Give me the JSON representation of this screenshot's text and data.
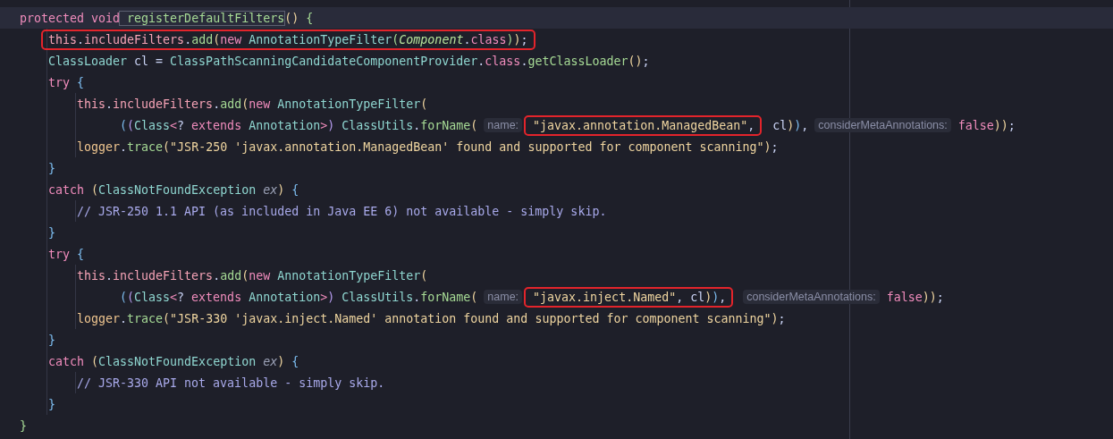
{
  "editor": {
    "lines": [
      {
        "current": true,
        "tokens": [
          {
            "kind": "keyword",
            "text": "protected void"
          },
          {
            "kind": "declaration",
            "text": "registerDefaultFilters",
            "space_before": true
          },
          {
            "kind": "paren-yellow",
            "text": "()"
          },
          {
            "kind": "paren-green",
            "text": "{",
            "space_before": true
          }
        ],
        "children": [
          {
            "tokens": [
              {
                "kind": "boxed",
                "tokens": [
                  {
                    "kind": "field",
                    "text": "this"
                  },
                  {
                    "kind": "plain",
                    "text": "."
                  },
                  {
                    "kind": "field",
                    "text": "includeFilters"
                  },
                  {
                    "kind": "plain",
                    "text": "."
                  },
                  {
                    "kind": "method",
                    "text": "add"
                  },
                  {
                    "kind": "paren-yellow",
                    "text": "("
                  },
                  {
                    "kind": "keyword",
                    "text": "new"
                  },
                  {
                    "kind": "type",
                    "text": "AnnotationTypeFilter",
                    "space_before": true
                  },
                  {
                    "kind": "paren-green",
                    "text": "("
                  },
                  {
                    "kind": "italic-type",
                    "text": "Component"
                  },
                  {
                    "kind": "plain",
                    "text": "."
                  },
                  {
                    "kind": "keyword",
                    "text": "class"
                  },
                  {
                    "kind": "paren-green",
                    "text": ")"
                  },
                  {
                    "kind": "paren-yellow",
                    "text": ")"
                  },
                  {
                    "kind": "plain",
                    "text": ";"
                  }
                ]
              }
            ]
          },
          {
            "tokens": [
              {
                "kind": "type",
                "text": "ClassLoader"
              },
              {
                "kind": "plain",
                "text": "cl",
                "space_before": true
              },
              {
                "kind": "plain",
                "text": "=",
                "space_before": true
              },
              {
                "kind": "type",
                "text": "ClassPathScanningCandidateComponentProvider",
                "space_before": true
              },
              {
                "kind": "plain",
                "text": "."
              },
              {
                "kind": "keyword",
                "text": "class"
              },
              {
                "kind": "plain",
                "text": "."
              },
              {
                "kind": "method",
                "text": "getClassLoader"
              },
              {
                "kind": "paren-yellow",
                "text": "()"
              },
              {
                "kind": "plain",
                "text": ";"
              }
            ]
          },
          {
            "tokens": [
              {
                "kind": "keyword",
                "text": "try"
              },
              {
                "kind": "paren-blue",
                "text": "{",
                "space_before": true
              }
            ],
            "children": [
              {
                "tokens": [
                  {
                    "kind": "field",
                    "text": "this"
                  },
                  {
                    "kind": "plain",
                    "text": "."
                  },
                  {
                    "kind": "field",
                    "text": "includeFilters"
                  },
                  {
                    "kind": "plain",
                    "text": "."
                  },
                  {
                    "kind": "method",
                    "text": "add"
                  },
                  {
                    "kind": "paren-yellow",
                    "text": "("
                  },
                  {
                    "kind": "keyword",
                    "text": "new"
                  },
                  {
                    "kind": "type",
                    "text": "AnnotationTypeFilter",
                    "space_before": true
                  },
                  {
                    "kind": "paren-yellow",
                    "text": "("
                  }
                ]
              },
              {
                "continuation": true,
                "tokens": [
                  {
                    "kind": "paren-blue",
                    "text": "("
                  },
                  {
                    "kind": "paren-purple",
                    "text": "("
                  },
                  {
                    "kind": "type",
                    "text": "Class"
                  },
                  {
                    "kind": "keyword",
                    "text": "<"
                  },
                  {
                    "kind": "plain",
                    "text": "?"
                  },
                  {
                    "kind": "keyword",
                    "text": "extends",
                    "space_before": true
                  },
                  {
                    "kind": "type",
                    "text": "Annotation",
                    "space_before": true
                  },
                  {
                    "kind": "keyword",
                    "text": ">"
                  },
                  {
                    "kind": "paren-purple",
                    "text": ")"
                  },
                  {
                    "kind": "type",
                    "text": "ClassUtils",
                    "space_before": true
                  },
                  {
                    "kind": "plain",
                    "text": "."
                  },
                  {
                    "kind": "method",
                    "text": "forName"
                  },
                  {
                    "kind": "paren-yellow",
                    "text": "("
                  },
                  {
                    "kind": "hint",
                    "text": "name:",
                    "space_before": true
                  },
                  {
                    "kind": "boxed",
                    "space_before": true,
                    "tokens": [
                      {
                        "kind": "string",
                        "text": "\"javax.annotation.ManagedBean\""
                      },
                      {
                        "kind": "plain",
                        "text": ","
                      }
                    ]
                  },
                  {
                    "kind": "plain",
                    "text": "cl",
                    "space_before": true
                  },
                  {
                    "kind": "paren-yellow",
                    "text": ")"
                  },
                  {
                    "kind": "paren-blue",
                    "text": ")"
                  },
                  {
                    "kind": "plain",
                    "text": ","
                  },
                  {
                    "kind": "hint",
                    "text": "considerMetaAnnotations:",
                    "space_before": true
                  },
                  {
                    "kind": "keyword",
                    "text": "false",
                    "space_before": true
                  },
                  {
                    "kind": "paren-yellow",
                    "text": ")"
                  },
                  {
                    "kind": "paren-yellow",
                    "text": ")"
                  },
                  {
                    "kind": "plain",
                    "text": ";"
                  }
                ]
              },
              {
                "tokens": [
                  {
                    "kind": "static-field",
                    "text": "logger"
                  },
                  {
                    "kind": "plain",
                    "text": "."
                  },
                  {
                    "kind": "method",
                    "text": "trace"
                  },
                  {
                    "kind": "paren-yellow",
                    "text": "("
                  },
                  {
                    "kind": "string",
                    "text": "\"JSR-250 'javax.annotation.ManagedBean' found and supported for component scanning\""
                  },
                  {
                    "kind": "paren-yellow",
                    "text": ")"
                  },
                  {
                    "kind": "plain",
                    "text": ";"
                  }
                ]
              }
            ]
          },
          {
            "tokens": [
              {
                "kind": "paren-blue",
                "text": "}"
              }
            ]
          },
          {
            "tokens": [
              {
                "kind": "keyword",
                "text": "catch"
              },
              {
                "kind": "paren-yellow",
                "text": "(",
                "space_before": true
              },
              {
                "kind": "type",
                "text": "ClassNotFoundException"
              },
              {
                "kind": "parameter",
                "text": "ex",
                "space_before": true
              },
              {
                "kind": "paren-yellow",
                "text": ")"
              },
              {
                "kind": "paren-blue",
                "text": "{",
                "space_before": true
              }
            ],
            "children": [
              {
                "tokens": [
                  {
                    "kind": "comment",
                    "text": "// JSR-250 1.1 API (as included in Java EE 6) not available - simply skip."
                  }
                ]
              }
            ]
          },
          {
            "tokens": [
              {
                "kind": "paren-blue",
                "text": "}"
              }
            ]
          },
          {
            "tokens": [
              {
                "kind": "keyword",
                "text": "try"
              },
              {
                "kind": "paren-blue",
                "text": "{",
                "space_before": true
              }
            ],
            "children": [
              {
                "tokens": [
                  {
                    "kind": "field",
                    "text": "this"
                  },
                  {
                    "kind": "plain",
                    "text": "."
                  },
                  {
                    "kind": "field",
                    "text": "includeFilters"
                  },
                  {
                    "kind": "plain",
                    "text": "."
                  },
                  {
                    "kind": "method",
                    "text": "add"
                  },
                  {
                    "kind": "paren-yellow",
                    "text": "("
                  },
                  {
                    "kind": "keyword",
                    "text": "new"
                  },
                  {
                    "kind": "type",
                    "text": "AnnotationTypeFilter",
                    "space_before": true
                  },
                  {
                    "kind": "paren-yellow",
                    "text": "("
                  }
                ]
              },
              {
                "continuation": true,
                "tokens": [
                  {
                    "kind": "paren-blue",
                    "text": "("
                  },
                  {
                    "kind": "paren-purple",
                    "text": "("
                  },
                  {
                    "kind": "type",
                    "text": "Class"
                  },
                  {
                    "kind": "keyword",
                    "text": "<"
                  },
                  {
                    "kind": "plain",
                    "text": "?"
                  },
                  {
                    "kind": "keyword",
                    "text": "extends",
                    "space_before": true
                  },
                  {
                    "kind": "type",
                    "text": "Annotation",
                    "space_before": true
                  },
                  {
                    "kind": "keyword",
                    "text": ">"
                  },
                  {
                    "kind": "paren-purple",
                    "text": ")"
                  },
                  {
                    "kind": "type",
                    "text": "ClassUtils",
                    "space_before": true
                  },
                  {
                    "kind": "plain",
                    "text": "."
                  },
                  {
                    "kind": "method",
                    "text": "forName"
                  },
                  {
                    "kind": "paren-yellow",
                    "text": "("
                  },
                  {
                    "kind": "hint",
                    "text": "name:",
                    "space_before": true
                  },
                  {
                    "kind": "boxed",
                    "space_before": true,
                    "tokens": [
                      {
                        "kind": "string",
                        "text": "\"javax.inject.Named\""
                      },
                      {
                        "kind": "plain",
                        "text": ","
                      },
                      {
                        "kind": "plain",
                        "text": "cl",
                        "space_before": true
                      },
                      {
                        "kind": "paren-yellow",
                        "text": ")"
                      },
                      {
                        "kind": "paren-blue",
                        "text": ")"
                      },
                      {
                        "kind": "plain",
                        "text": ","
                      }
                    ]
                  },
                  {
                    "kind": "hint",
                    "text": "considerMetaAnnotations:",
                    "space_before": true
                  },
                  {
                    "kind": "keyword",
                    "text": "false",
                    "space_before": true
                  },
                  {
                    "kind": "paren-yellow",
                    "text": ")"
                  },
                  {
                    "kind": "paren-yellow",
                    "text": ")"
                  },
                  {
                    "kind": "plain",
                    "text": ";"
                  }
                ]
              },
              {
                "tokens": [
                  {
                    "kind": "static-field",
                    "text": "logger"
                  },
                  {
                    "kind": "plain",
                    "text": "."
                  },
                  {
                    "kind": "method",
                    "text": "trace"
                  },
                  {
                    "kind": "paren-yellow",
                    "text": "("
                  },
                  {
                    "kind": "string",
                    "text": "\"JSR-330 'javax.inject.Named' annotation found and supported for component scanning\""
                  },
                  {
                    "kind": "paren-yellow",
                    "text": ")"
                  },
                  {
                    "kind": "plain",
                    "text": ";"
                  }
                ]
              }
            ]
          },
          {
            "tokens": [
              {
                "kind": "paren-blue",
                "text": "}"
              }
            ]
          },
          {
            "tokens": [
              {
                "kind": "keyword",
                "text": "catch"
              },
              {
                "kind": "paren-yellow",
                "text": "(",
                "space_before": true
              },
              {
                "kind": "type",
                "text": "ClassNotFoundException"
              },
              {
                "kind": "parameter",
                "text": "ex",
                "space_before": true
              },
              {
                "kind": "paren-yellow",
                "text": ")"
              },
              {
                "kind": "paren-blue",
                "text": "{",
                "space_before": true
              }
            ],
            "children": [
              {
                "tokens": [
                  {
                    "kind": "comment",
                    "text": "// JSR-330 API not available - simply skip."
                  }
                ]
              }
            ]
          },
          {
            "tokens": [
              {
                "kind": "paren-blue",
                "text": "}"
              }
            ]
          }
        ]
      },
      {
        "tokens": [
          {
            "kind": "paren-green",
            "text": "}"
          }
        ]
      }
    ]
  }
}
